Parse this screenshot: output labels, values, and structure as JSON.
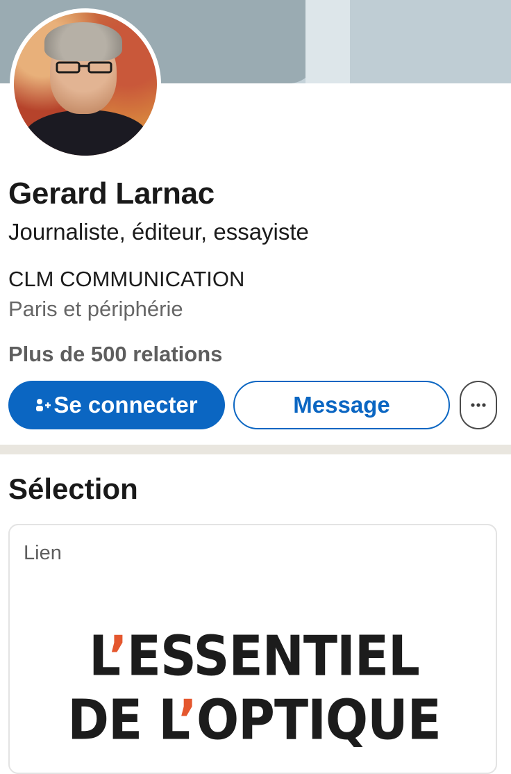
{
  "profile": {
    "name": "Gerard Larnac",
    "headline": "Journaliste, éditeur, essayiste",
    "company": "CLM COMMUNICATION",
    "location": "Paris et périphérie",
    "connections": "Plus de 500 relations"
  },
  "actions": {
    "connect_label": "Se connecter",
    "message_label": "Message",
    "more_icon": "ellipsis-icon"
  },
  "featured": {
    "title": "Sélection",
    "card_type": "Lien",
    "logo_line1": "L’ESSENTIEL",
    "logo_line2": "DE L’OPTIQUE"
  },
  "colors": {
    "accent": "#0b66c2",
    "logo_apostrophe": "#e4572e"
  }
}
